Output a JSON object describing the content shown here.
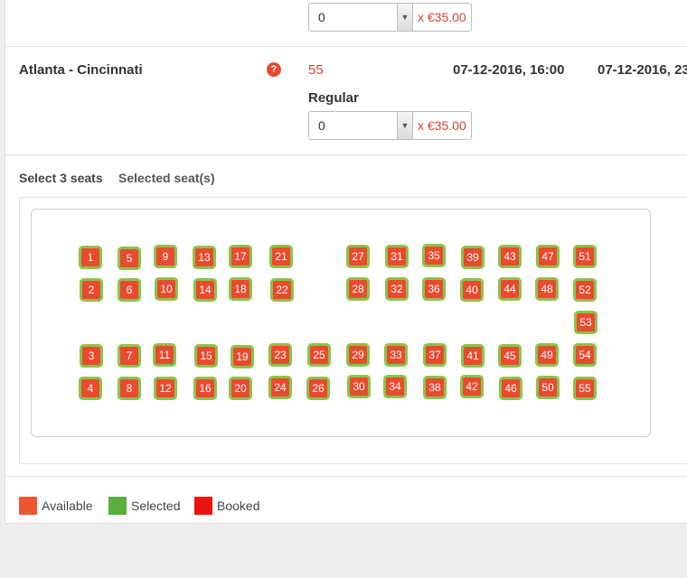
{
  "top_row": {
    "quantity_value": "0",
    "price_suffix": "x €35.00"
  },
  "trip": {
    "route": "Atlanta - Cincinnati",
    "help_icon": "question-icon",
    "price": "55",
    "departure": "07-12-2016, 16:00",
    "arrival": "07-12-2016, 23",
    "ticket_type": "Regular",
    "quantity_value": "0",
    "price_suffix": "x €35.00"
  },
  "seat_selection": {
    "select_label": "Select 3 seats",
    "selected_label": "Selected seat(s)",
    "seats": [
      "1",
      "2",
      "3",
      "4",
      "5",
      "6",
      "7",
      "8",
      "9",
      "10",
      "11",
      "12",
      "13",
      "14",
      "15",
      "16",
      "17",
      "18",
      "19",
      "20",
      "21",
      "22",
      "23",
      "24",
      "25",
      "26",
      "27",
      "28",
      "29",
      "30",
      "31",
      "32",
      "33",
      "34",
      "35",
      "36",
      "37",
      "38",
      "39",
      "40",
      "41",
      "42",
      "43",
      "44",
      "45",
      "46",
      "47",
      "48",
      "49",
      "50",
      "51",
      "52",
      "53",
      "54",
      "55"
    ]
  },
  "legend": {
    "available": "Available",
    "selected": "Selected",
    "booked": "Booked"
  },
  "colors": {
    "available": "#ea4a2e",
    "selected": "#5aae3b",
    "booked": "#ee1111",
    "accent": "#d9432f"
  }
}
